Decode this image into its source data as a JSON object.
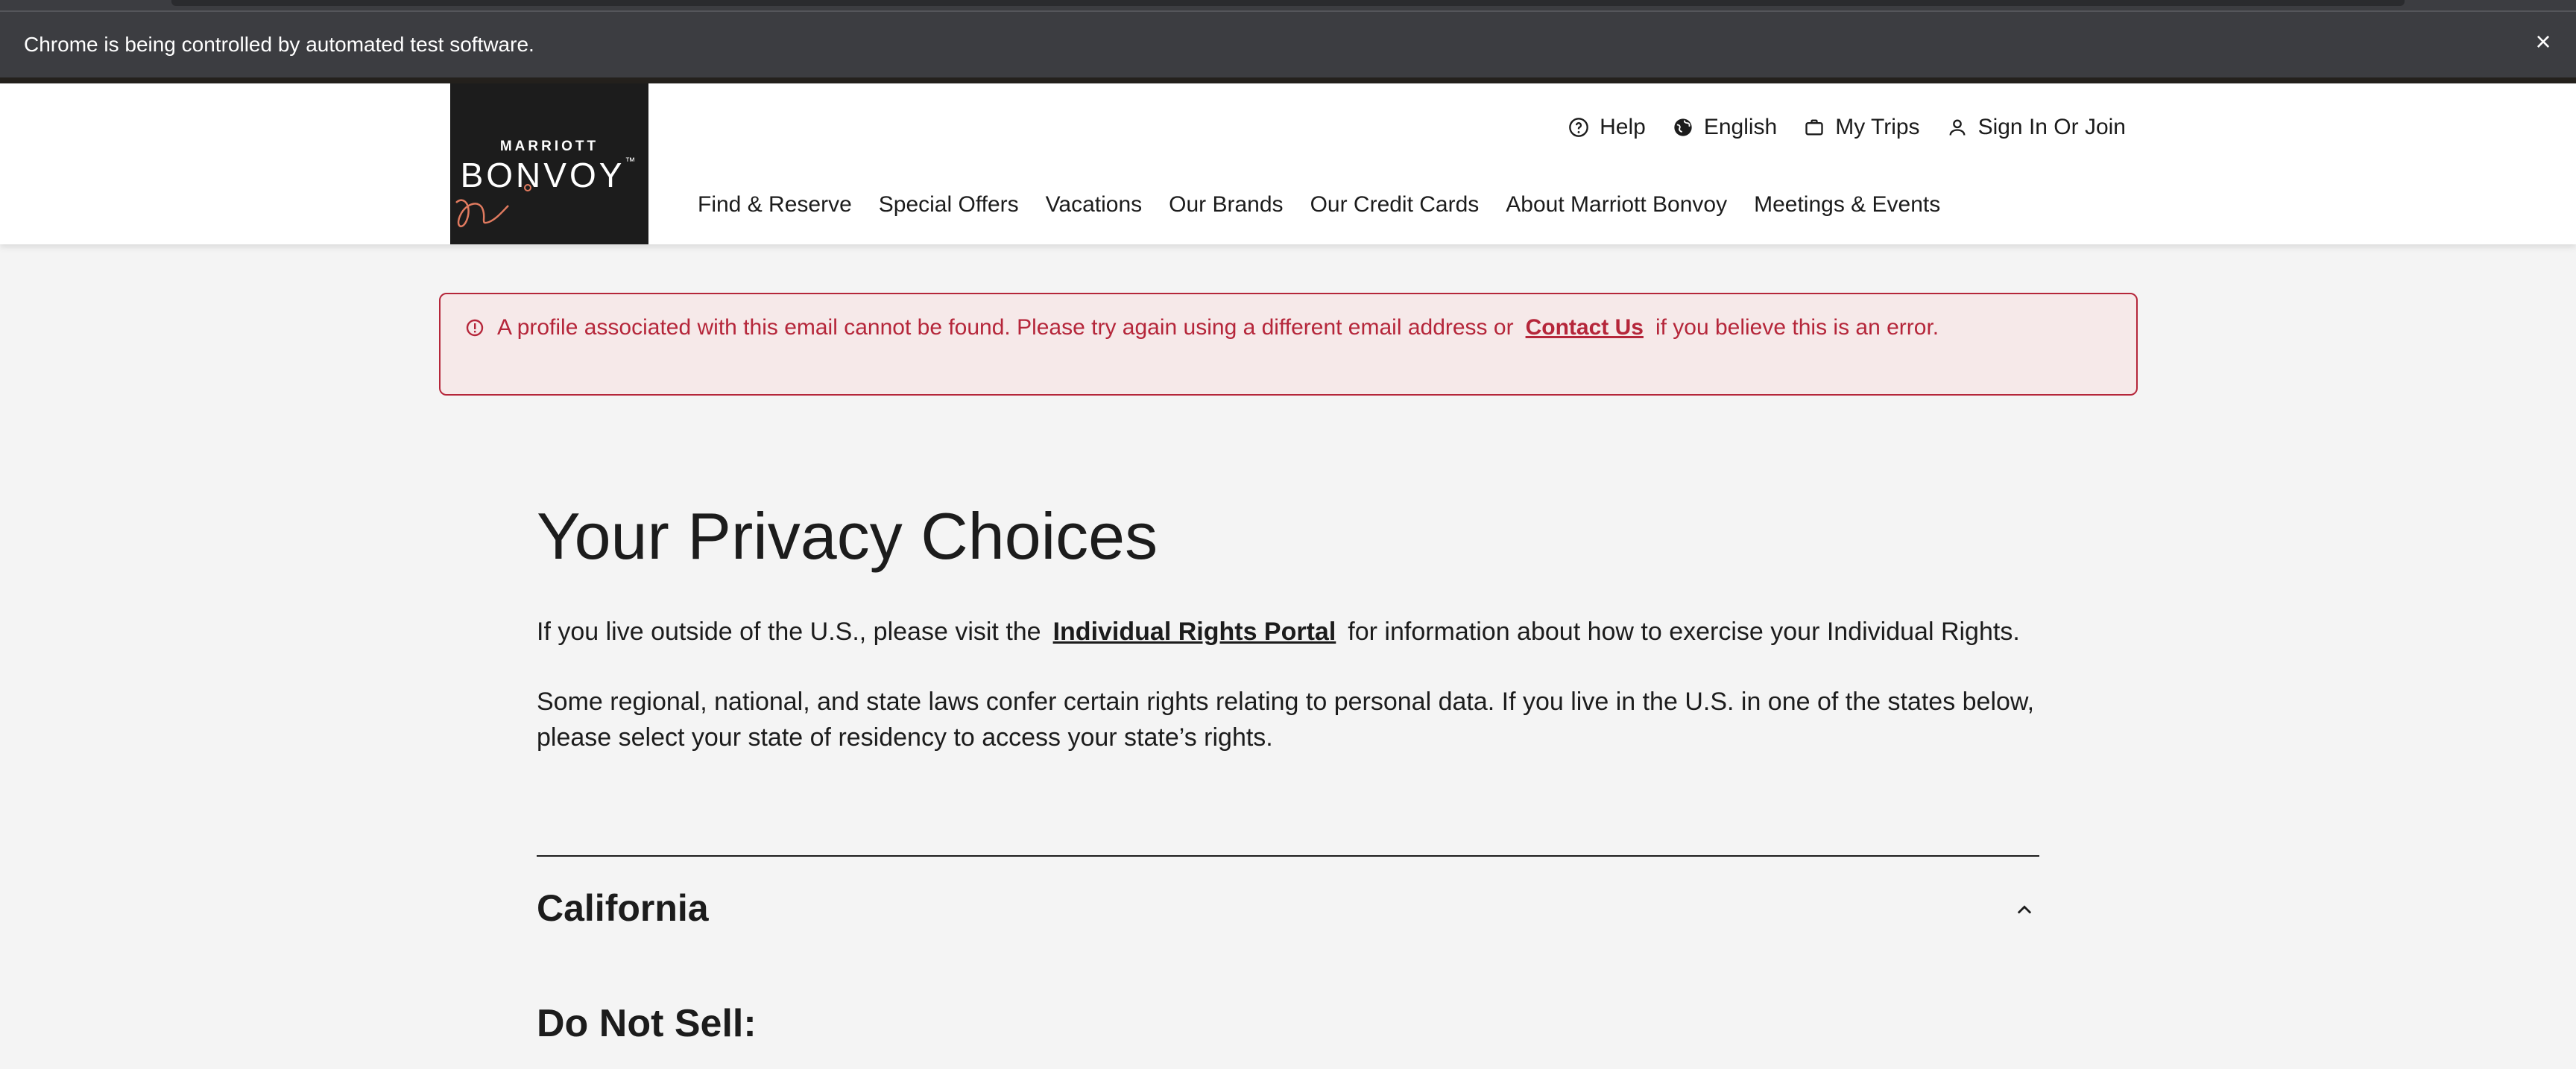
{
  "browser": {
    "automation_message": "Chrome is being controlled by automated test software.",
    "close_label": "×"
  },
  "header": {
    "logo": {
      "line1": "MARRIOTT",
      "line2": "BONVOY",
      "trademark": "™"
    },
    "utility_nav": [
      {
        "label": "Help",
        "icon": "help-circle-icon"
      },
      {
        "label": "English",
        "icon": "globe-icon"
      },
      {
        "label": "My Trips",
        "icon": "suitcase-icon"
      },
      {
        "label": "Sign In Or Join",
        "icon": "user-icon"
      }
    ],
    "main_nav": [
      {
        "label": "Find & Reserve"
      },
      {
        "label": "Special Offers"
      },
      {
        "label": "Vacations"
      },
      {
        "label": "Our Brands"
      },
      {
        "label": "Our Credit Cards"
      },
      {
        "label": "About Marriott Bonvoy"
      },
      {
        "label": "Meetings & Events"
      }
    ]
  },
  "alert": {
    "text_before": "A profile associated with this email cannot be found. Please try again using a different email address or",
    "link": "Contact Us",
    "text_after": "if you believe this is an error.",
    "color": "#b5263a",
    "background": "#f6e9e9"
  },
  "content": {
    "title": "Your Privacy Choices",
    "para1_before": "If you live outside of the U.S., please visit the",
    "para1_link": "Individual Rights Portal",
    "para1_after": "for information about how to exercise your Individual Rights.",
    "para2": "Some regional, national, and state laws confer certain rights relating to personal data. If you live in the U.S. in one of the states below, please select your state of residency to access your state’s rights.",
    "accordion": {
      "title": "California",
      "expanded": true,
      "icon": "chevron-up-icon"
    },
    "subheading": "Do Not Sell:"
  }
}
